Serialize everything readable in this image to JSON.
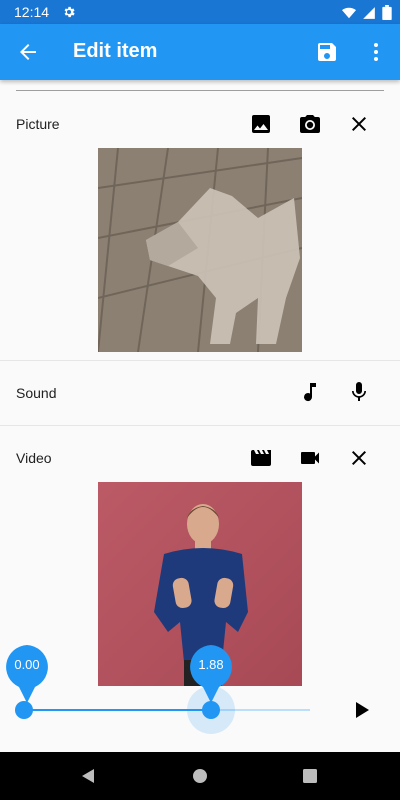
{
  "status_bar": {
    "time": "12:14",
    "icons": [
      "settings-icon",
      "wifi-icon",
      "signal-icon",
      "battery-icon"
    ]
  },
  "app_bar": {
    "title": "Edit item",
    "back_icon": "arrow-back-icon",
    "save_icon": "save-icon",
    "more_icon": "more-vert-icon",
    "color": "#2196f3"
  },
  "picture": {
    "label": "Picture",
    "actions": [
      "image-icon",
      "camera-icon",
      "close-icon"
    ]
  },
  "sound": {
    "label": "Sound",
    "actions": [
      "music-note-icon",
      "mic-icon"
    ]
  },
  "video": {
    "label": "Video",
    "actions": [
      "movie-icon",
      "videocam-icon",
      "close-icon"
    ]
  },
  "trim_slider": {
    "start_label": "0.00",
    "end_label": "1.88",
    "start_fraction": 0.0,
    "end_fraction": 0.65,
    "accent": "#2196f3"
  },
  "play_icon": "play-arrow-icon",
  "nav_bar": {
    "icons": [
      "back-triangle-icon",
      "home-circle-icon",
      "recents-square-icon"
    ]
  }
}
